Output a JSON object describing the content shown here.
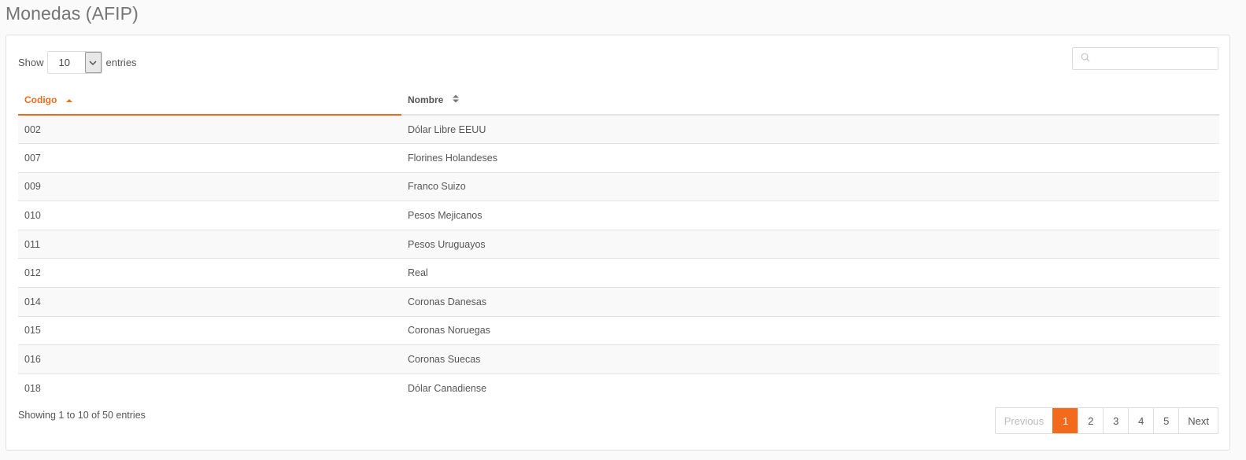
{
  "page": {
    "title": "Monedas (AFIP)"
  },
  "length": {
    "label_before": "Show",
    "selected": "10",
    "label_after": "entries"
  },
  "search": {
    "placeholder": ""
  },
  "table": {
    "columns": [
      "Codigo",
      "Nombre"
    ],
    "rows": [
      [
        "002",
        "Dólar Libre EEUU"
      ],
      [
        "007",
        "Florines Holandeses"
      ],
      [
        "009",
        "Franco Suizo"
      ],
      [
        "010",
        "Pesos Mejicanos"
      ],
      [
        "011",
        "Pesos Uruguayos"
      ],
      [
        "012",
        "Real"
      ],
      [
        "014",
        "Coronas Danesas"
      ],
      [
        "015",
        "Coronas Noruegas"
      ],
      [
        "016",
        "Coronas Suecas"
      ],
      [
        "018",
        "Dólar Canadiense"
      ]
    ]
  },
  "info": "Showing 1 to 10 of 50 entries",
  "pagination": {
    "previous": "Previous",
    "pages": [
      "1",
      "2",
      "3",
      "4",
      "5"
    ],
    "active_page": "1",
    "next": "Next"
  },
  "colors": {
    "accent": "#f26a1b",
    "border": "#e3e3e3",
    "stripe": "#f9f9f9"
  }
}
